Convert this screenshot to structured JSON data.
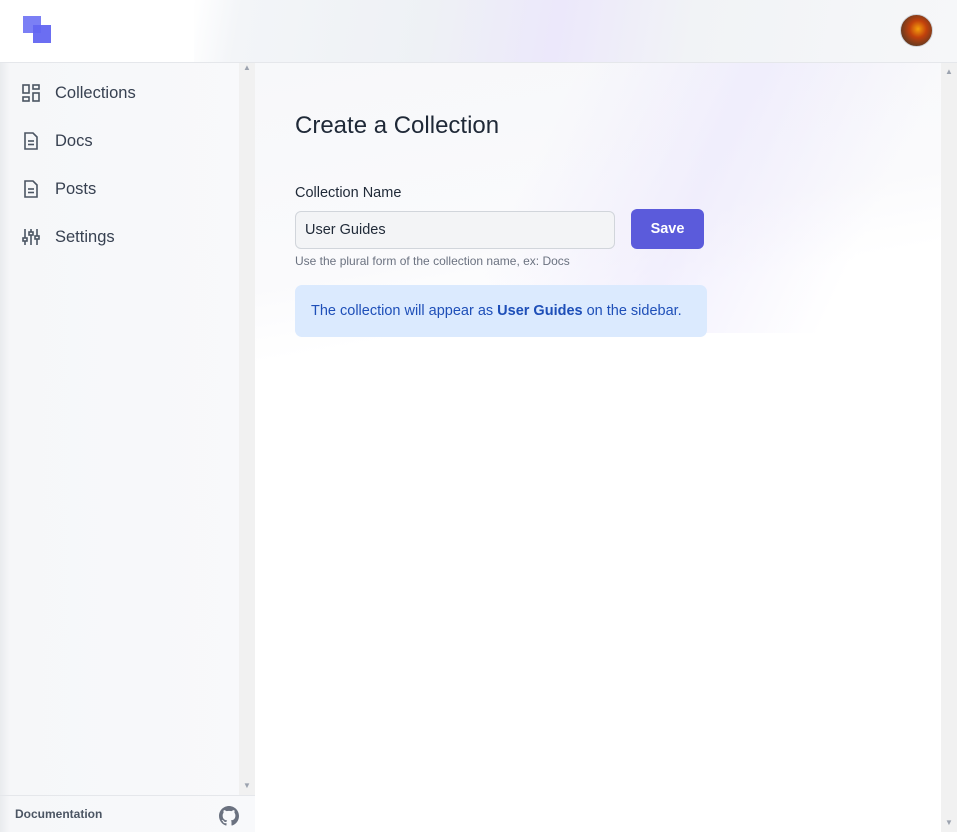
{
  "header": {
    "logo": "app-logo",
    "avatar": "user-avatar"
  },
  "sidebar": {
    "items": [
      {
        "label": "Collections",
        "icon": "grid-icon"
      },
      {
        "label": "Docs",
        "icon": "document-icon"
      },
      {
        "label": "Posts",
        "icon": "document-icon"
      },
      {
        "label": "Settings",
        "icon": "sliders-icon"
      }
    ],
    "footer": {
      "documentation_label": "Documentation",
      "github_icon": "github-icon"
    }
  },
  "main": {
    "title": "Create a Collection",
    "field_label": "Collection Name",
    "input_value": "User Guides",
    "save_label": "Save",
    "help_text": "Use the plural form of the collection name, ex: Docs",
    "info": {
      "prefix": "The collection will appear as",
      "highlight": "User Guides",
      "suffix": "on the sidebar."
    }
  },
  "colors": {
    "accent": "#5b5bdb",
    "info_bg": "#dbeafe",
    "info_text": "#1e4fb8"
  }
}
